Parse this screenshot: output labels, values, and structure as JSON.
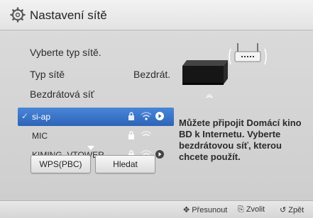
{
  "header": {
    "title": "Nastavení sítě",
    "icon": "gear-icon"
  },
  "main": {
    "prompt": "Vyberte typ sítě.",
    "network_type_label": "Typ sítě",
    "network_type_value": "Bezdrát.",
    "wireless_label": "Bezdrátová síť",
    "networks": [
      {
        "name": "si-ap",
        "selected": true,
        "checked": true,
        "locked": true,
        "signal": "strong",
        "has_arrow": true
      },
      {
        "name": "MIC",
        "selected": false,
        "checked": false,
        "locked": true,
        "signal": "medium",
        "has_arrow": false
      },
      {
        "name": "KIMING_VTOWER",
        "selected": false,
        "checked": false,
        "locked": true,
        "signal": "strong",
        "has_arrow": true
      }
    ],
    "buttons": {
      "wps": "WPS(PBC)",
      "search": "Hledat"
    },
    "description": "Můžete připojit Domácí kino BD k Internetu. Vyberte bezdrátovou síť, kterou chcete použít."
  },
  "footer": {
    "move": "Přesunout",
    "select": "Zvolit",
    "back": "Zpět"
  },
  "colors": {
    "selection": "#3a74c8",
    "background": "#d2d2d2"
  }
}
